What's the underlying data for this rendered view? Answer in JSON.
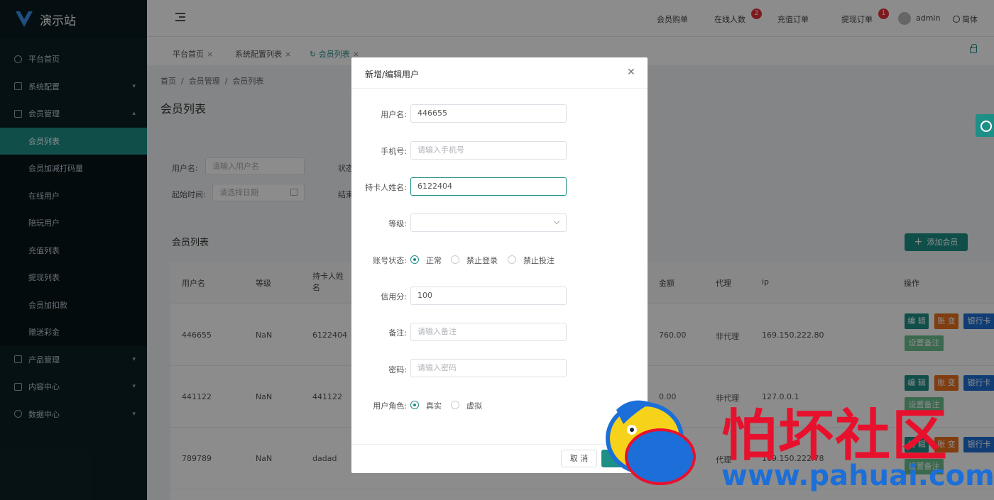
{
  "app": {
    "name": "演示站"
  },
  "sidebar": {
    "items": [
      {
        "label": "平台首页"
      },
      {
        "label": "系统配置"
      },
      {
        "label": "会员管理"
      },
      {
        "label": "产品管理"
      },
      {
        "label": "内容中心"
      },
      {
        "label": "数据中心"
      }
    ],
    "submenu": [
      {
        "label": "会员列表"
      },
      {
        "label": "会员加减打码量"
      },
      {
        "label": "在线用户"
      },
      {
        "label": "陪玩用户"
      },
      {
        "label": "充值列表"
      },
      {
        "label": "提现列表"
      },
      {
        "label": "会员加扣款"
      },
      {
        "label": "赠送彩金"
      }
    ]
  },
  "header": {
    "member_buy": "会员购单",
    "online_count": "在线人数",
    "online_badge": "2",
    "recharge_orders": "充值订单",
    "withdraw_orders": "提现订单",
    "withdraw_badge": "1",
    "user": "admin",
    "language": "简体"
  },
  "tabs": [
    {
      "label": "平台首页"
    },
    {
      "label": "系统配置列表"
    },
    {
      "label": "会员列表"
    }
  ],
  "breadcrumb": [
    "首页",
    "会员管理",
    "会员列表"
  ],
  "page_title": "会员列表",
  "filter": {
    "username_label": "用户名:",
    "username_placeholder": "请输入用户名",
    "status_label": "状态",
    "start_label": "起始时间:",
    "start_placeholder": "请选择日期",
    "end_label": "结束"
  },
  "list": {
    "title": "会员列表",
    "add_button": "添加会员"
  },
  "table": {
    "headers": [
      "用户名",
      "等级",
      "持卡人姓名",
      "金额",
      "代理",
      "ip",
      "操作"
    ],
    "rows": [
      {
        "username": "446655",
        "level": "NaN",
        "holder": "6122404",
        "amount": "760.00",
        "agent": "非代理",
        "ip": "169.150.222.80"
      },
      {
        "username": "441122",
        "level": "NaN",
        "holder": "441122",
        "amount": "0.00",
        "agent": "非代理",
        "ip": "127.0.0.1"
      },
      {
        "username": "789789",
        "level": "NaN",
        "holder": "dadad",
        "amount": "",
        "agent": "代理",
        "ip": "169.150.222.78"
      }
    ],
    "actions": {
      "edit": "编 辑",
      "account": "账 变",
      "bank": "银行卡",
      "note": "设置备注"
    }
  },
  "modal": {
    "title": "新增/编辑用户",
    "fields": {
      "username_label": "用户名:",
      "username_value": "446655",
      "phone_label": "手机号:",
      "phone_placeholder": "请输入手机号",
      "holder_label": "持卡人姓名:",
      "holder_value": "6122404",
      "level_label": "等级:",
      "status_label": "账号状态:",
      "status_options": [
        "正常",
        "禁止登录",
        "禁止投注"
      ],
      "credit_label": "信用分:",
      "credit_value": "100",
      "note_label": "备注:",
      "note_placeholder": "请输入备注",
      "password_label": "密码:",
      "password_placeholder": "请输入密码",
      "role_label": "用户角色:",
      "role_options": [
        "真实",
        "虚拟"
      ]
    },
    "cancel": "取 消"
  },
  "watermark": {
    "cn": "怕坏社区",
    "url": "www.pahuai.com"
  },
  "colors": {
    "accent": "#1e8f87",
    "sidebar": "#0b2024",
    "badge": "#e3313a",
    "orange": "#e8701e",
    "blue": "#1e6fd3"
  }
}
